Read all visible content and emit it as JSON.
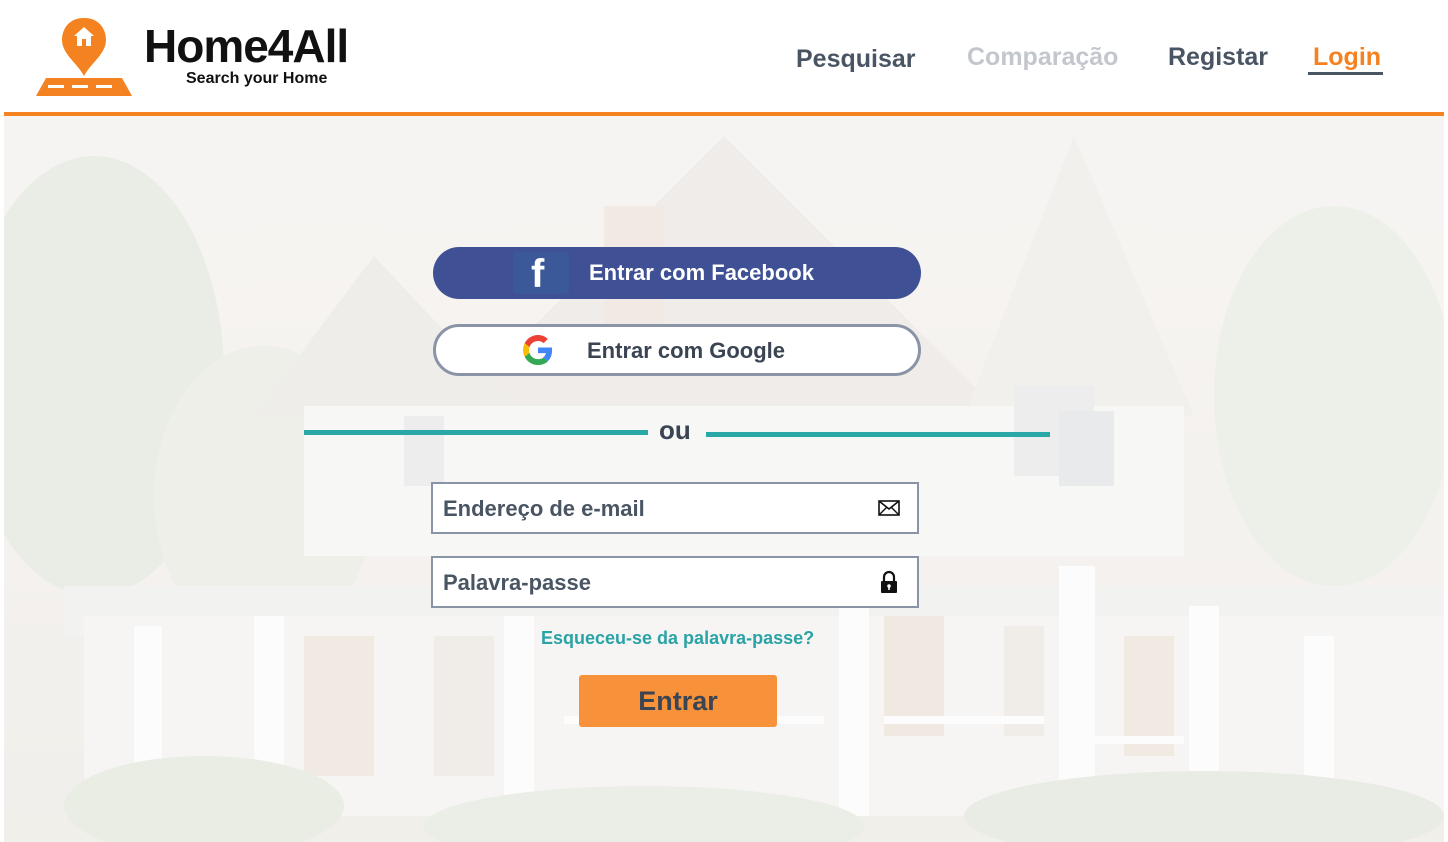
{
  "brand": {
    "name": "Home4All",
    "tagline": "Search your Home"
  },
  "nav": {
    "items": [
      {
        "label": "Pesquisar",
        "state": "normal"
      },
      {
        "label": "Comparação",
        "state": "disabled"
      },
      {
        "label": "Registar",
        "state": "normal"
      },
      {
        "label": "Login",
        "state": "active"
      }
    ]
  },
  "login": {
    "facebook_label": "Entrar com Facebook",
    "google_label": "Entrar com Google",
    "divider_label": "ou",
    "email_placeholder": "Endereço de e-mail",
    "password_placeholder": "Palavra-passe",
    "forgot_label": "Esqueceu-se da palavra-passe?",
    "submit_label": "Entrar"
  },
  "icons": {
    "logo": "map-pin-house-icon",
    "facebook": "facebook-icon",
    "google": "google-icon",
    "email": "envelope-icon",
    "password": "lock-icon"
  },
  "colors": {
    "accent": "#f58220",
    "facebook": "#3f5194",
    "teal": "#2aa8a8",
    "text": "#4a5563"
  }
}
